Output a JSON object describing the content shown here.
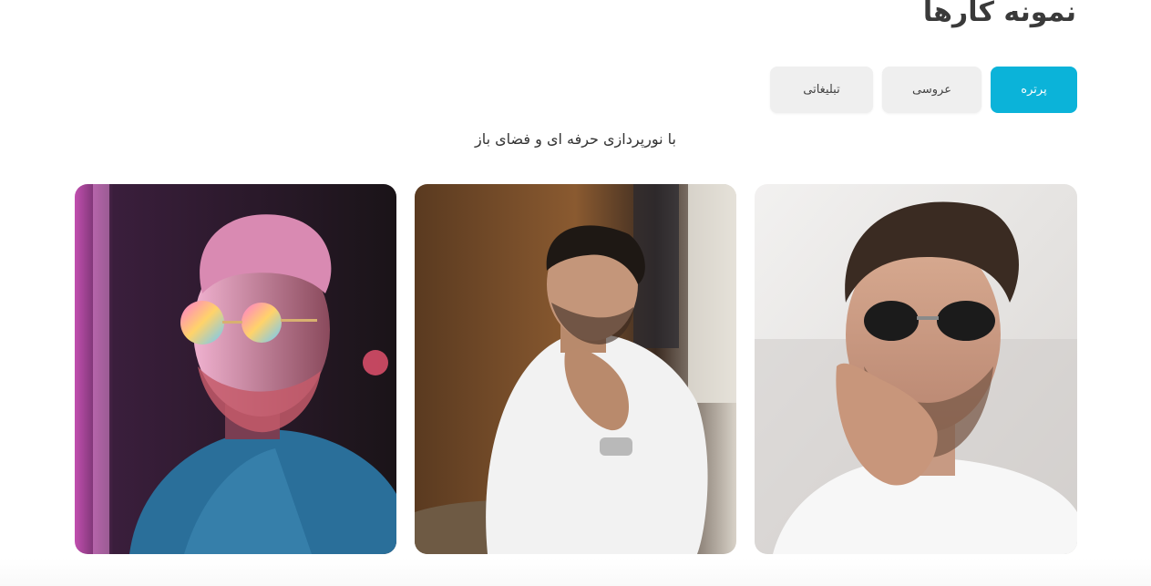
{
  "section": {
    "title": "نمونه کارها",
    "subtitle": "با نورپردازی حرفه ای و فضای باز"
  },
  "tabs": [
    {
      "label": "پرتره",
      "active": true
    },
    {
      "label": "عروسی",
      "active": false
    },
    {
      "label": "تبلیغاتی",
      "active": false
    }
  ],
  "colors": {
    "accent": "#0bb3d9",
    "tab_inactive": "#efefef",
    "text": "#333333"
  }
}
